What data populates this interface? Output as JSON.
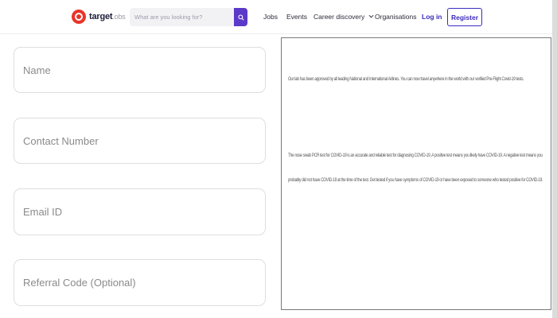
{
  "brand": {
    "name": "target",
    "suffix": ".obs"
  },
  "search": {
    "placeholder": "What are you looking for?"
  },
  "nav": {
    "jobs": "Jobs",
    "events": "Events",
    "career": "Career discovery",
    "organisations": "Organisations",
    "login": "Log in",
    "register": "Register"
  },
  "form": {
    "name_placeholder": "Name",
    "contact_placeholder": "Contact Number",
    "email_placeholder": "Email ID",
    "referral_placeholder": "Referral Code (Optional)"
  },
  "info": {
    "p1": "Our lab has been approved by all leading National and International Airlines. You can now travel anywhere in the world with our verified Pre-Flight Covid-19 tests.",
    "p2_line1": "The nose swab PCR test for COVID-19 is an accurate and reliable test for diagnosing COVID-19. A positive test means you likely have COVID-19. A negative test means you",
    "p2_line2": "probably did not have COVID-19 at the time of the test. Get tested if you have symptoms of COVID-19 or have been exposed to someone who tested positive for COVID-19."
  },
  "colors": {
    "accent": "#3b2bbf",
    "search_button": "#5b39c9",
    "logo": "#e8342a"
  }
}
